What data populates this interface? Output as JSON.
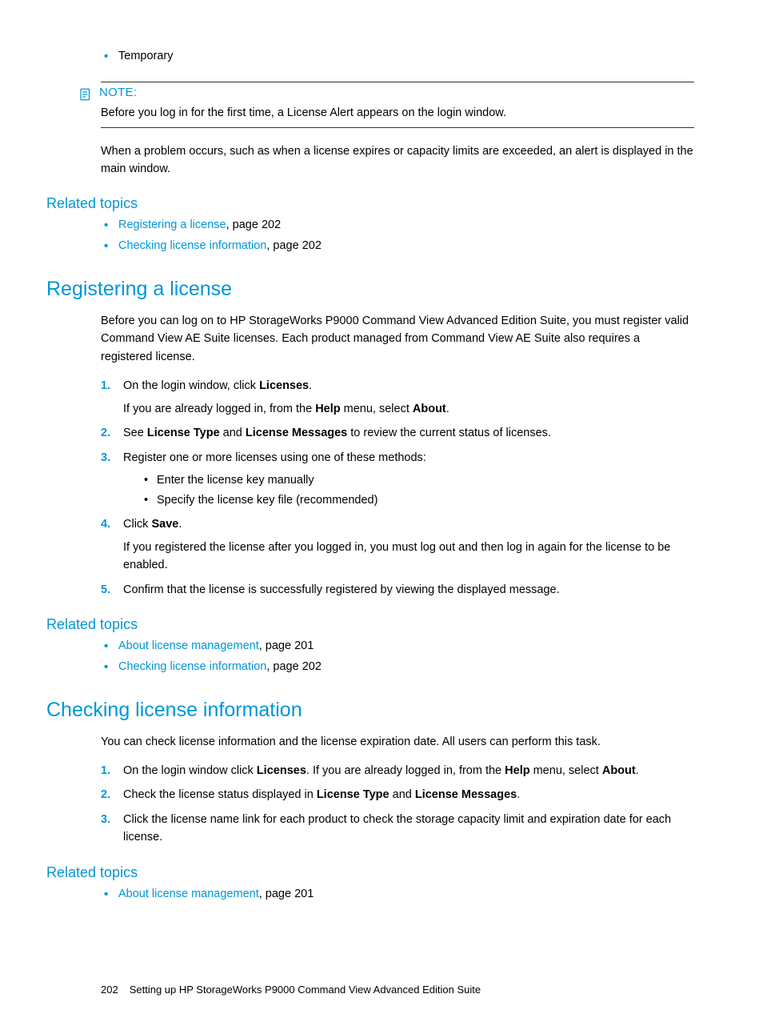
{
  "top_bullet": "Temporary",
  "note": {
    "label": "NOTE:",
    "body": "Before you log in for the first time, a License Alert appears on the login window."
  },
  "problem_para": "When a problem occurs, such as when a license expires or capacity limits are exceeded, an alert is displayed in the main window.",
  "related_topics_label": "Related topics",
  "rt1": [
    {
      "link": "Registering a license",
      "suffix": ", page 202"
    },
    {
      "link": "Checking license information",
      "suffix": ", page 202"
    }
  ],
  "reg": {
    "heading": "Registering a license",
    "intro": "Before you can log on to HP StorageWorks P9000 Command View Advanced Edition Suite, you must register valid Command View AE Suite licenses. Each product managed from Command View AE Suite also requires a registered license.",
    "steps": {
      "s1a": "On the login window, click ",
      "s1b": "Licenses",
      "s1c": ".",
      "s1sub_a": "If you are already logged in, from the ",
      "s1sub_b": "Help",
      "s1sub_c": " menu, select ",
      "s1sub_d": "About",
      "s1sub_e": ".",
      "s2a": "See ",
      "s2b": "License Type",
      "s2c": " and ",
      "s2d": "License Messages",
      "s2e": " to review the current status of licenses.",
      "s3": "Register one or more licenses using one of these methods:",
      "s3b1": "Enter the license key manually",
      "s3b2": "Specify the license key file (recommended)",
      "s4a": "Click ",
      "s4b": "Save",
      "s4c": ".",
      "s4sub": "If you registered the license after you logged in, you must log out and then log in again for the license to be enabled.",
      "s5": "Confirm that the license is successfully registered by viewing the displayed message."
    }
  },
  "rt2": [
    {
      "link": "About license management",
      "suffix": ", page 201"
    },
    {
      "link": "Checking license information",
      "suffix": ", page 202"
    }
  ],
  "chk": {
    "heading": "Checking license information",
    "intro": "You can check license information and the license expiration date. All users can perform this task.",
    "steps": {
      "s1a": "On the login window click ",
      "s1b": "Licenses",
      "s1c": ". If you are already logged in, from the ",
      "s1d": "Help",
      "s1e": " menu, select ",
      "s1f": "About",
      "s1g": ".",
      "s2a": "Check the license status displayed in ",
      "s2b": "License Type",
      "s2c": " and ",
      "s2d": "License Messages",
      "s2e": ".",
      "s3": "Click the license name link for each product to check the storage capacity limit and expiration date for each license."
    }
  },
  "rt3": [
    {
      "link": "About license management",
      "suffix": ", page 201"
    }
  ],
  "footer": {
    "page_num": "202",
    "chapter": "Setting up HP StorageWorks P9000 Command View Advanced Edition Suite"
  }
}
